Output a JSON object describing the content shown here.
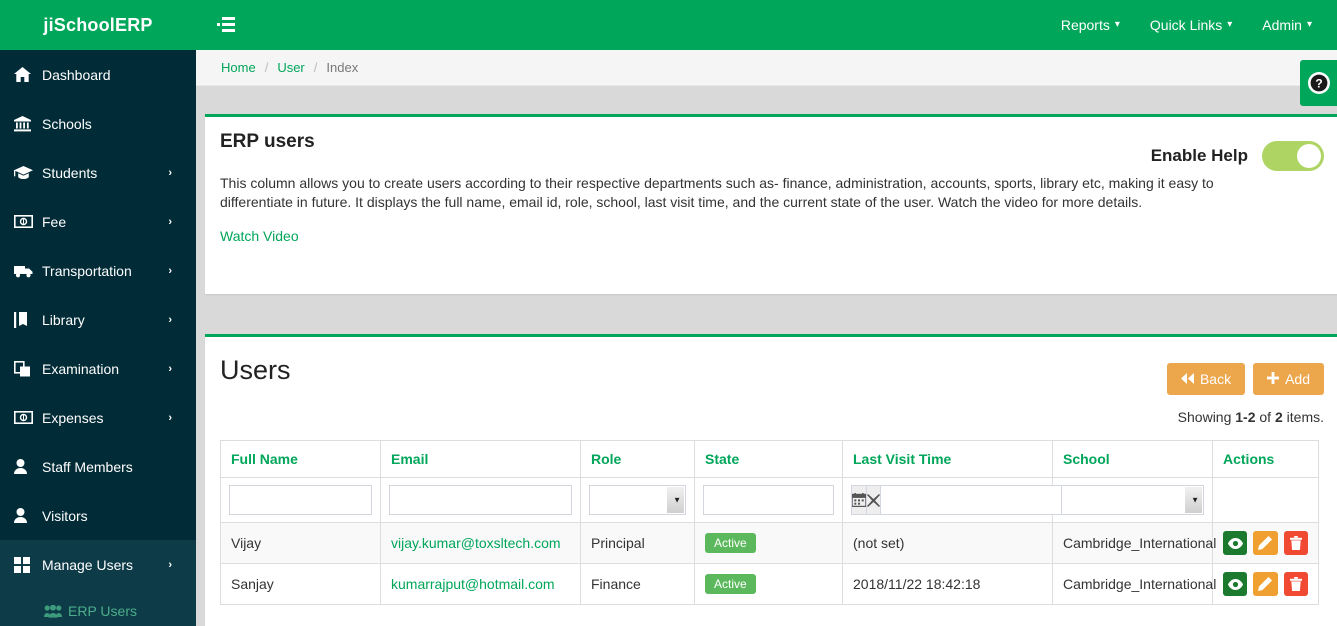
{
  "brand": {
    "name": "jiSchoolERP"
  },
  "topnav": {
    "items": [
      {
        "label": "Reports",
        "caret": "⌄"
      },
      {
        "label": "Quick Links",
        "caret": "⌄"
      },
      {
        "label": "Admin",
        "caret": "⌄"
      }
    ]
  },
  "sidebar": {
    "items": [
      {
        "label": "Dashboard",
        "icon": "home-icon",
        "arrow": ""
      },
      {
        "label": "Schools",
        "icon": "bank-icon",
        "arrow": ""
      },
      {
        "label": "Students",
        "icon": "graduation-cap-icon",
        "arrow": "›"
      },
      {
        "label": "Fee",
        "icon": "money-icon",
        "arrow": "›"
      },
      {
        "label": "Transportation",
        "icon": "truck-icon",
        "arrow": "›"
      },
      {
        "label": "Library",
        "icon": "book-icon",
        "arrow": "›"
      },
      {
        "label": "Examination",
        "icon": "copy-icon",
        "arrow": "›"
      },
      {
        "label": "Expenses",
        "icon": "money-icon",
        "arrow": "›"
      },
      {
        "label": "Staff Members",
        "icon": "user-icon",
        "arrow": ""
      },
      {
        "label": "Visitors",
        "icon": "user-icon",
        "arrow": ""
      },
      {
        "label": "Manage Users",
        "icon": "grid-icon",
        "arrow": "›"
      }
    ],
    "sub_item": {
      "label": "ERP Users",
      "icon": "users-group-icon"
    }
  },
  "breadcrumb": {
    "home": "Home",
    "user": "User",
    "index": "Index",
    "separator": "/"
  },
  "help_panel": {
    "title": "ERP users",
    "enable_help_label": "Enable Help",
    "enable_help_on": true,
    "description": "This column allows you to create users according to their respective departments such as- finance, administration, accounts, sports, library etc, making it easy to differentiate in future. It displays the full name, email id, role, school, last visit time, and the current state of the user. Watch the video for more details.",
    "watch_video": "Watch Video"
  },
  "users_panel": {
    "title": "Users",
    "back_label": "Back",
    "add_label": "Add",
    "summary_prefix": "Showing ",
    "summary_range": "1-2",
    "summary_of": " of ",
    "summary_total": "2",
    "summary_suffix": " items."
  },
  "table": {
    "headers": [
      "Full Name",
      "Email",
      "Role",
      "State",
      "Last Visit Time",
      "School",
      "Actions"
    ],
    "filters": {
      "full_name": "",
      "email": "",
      "role": "",
      "state": "",
      "last_visit_time": "",
      "school": ""
    },
    "rows": [
      {
        "full_name": "Vijay",
        "email": "vijay.kumar@toxsltech.com",
        "role": "Principal",
        "state": "Active",
        "last_visit_time": "(not set)",
        "school": "Cambridge_International"
      },
      {
        "full_name": "Sanjay",
        "email": "kumarrajput@hotmail.com",
        "role": "Finance",
        "state": "Active",
        "last_visit_time": "2018/11/22 18:42:18",
        "school": "Cambridge_International"
      }
    ]
  },
  "colors": {
    "brand_green": "#00a65a",
    "sidebar_dark": "#012b36",
    "accent_orange": "#eca64c",
    "badge_green": "#5cb85c",
    "toggle_on": "#aed463"
  }
}
